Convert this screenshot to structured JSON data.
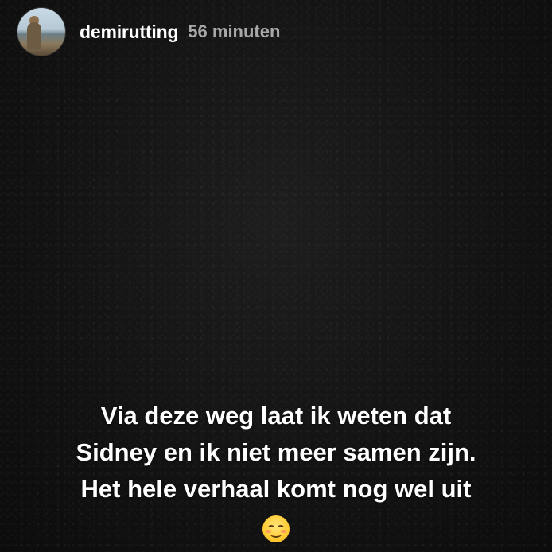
{
  "header": {
    "username": "demirutting",
    "time_ago": "56 minuten"
  },
  "caption": {
    "lines": [
      "Via deze weg laat ik weten dat",
      "Sidney en ik niet meer samen zijn.",
      "Het hele verhaal komt nog wel uit"
    ],
    "emoji": "smiling-face-emoji"
  },
  "colors": {
    "background": "#141414",
    "text": "#ffffff",
    "time": "#a8a8a8"
  }
}
